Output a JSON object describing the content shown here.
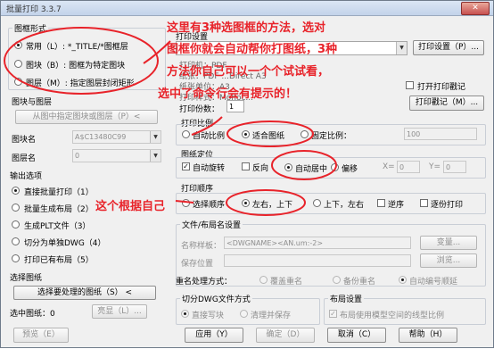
{
  "window": {
    "title": "批量打印 3.3.7",
    "close": "✕"
  },
  "pick": {
    "group": "图框形式",
    "opt1": "常用（L）: *_TITLE/*图框层",
    "opt2": "图块（B）: 图框为特定图块",
    "opt3": "图层（M）: 指定图层封闭矩形",
    "layer_group": "图块与图层",
    "pick_btn": "从图中指定图块或图层（P）<",
    "block_label": "图块名",
    "block_value": "A$C13480C99",
    "layer_label": "图层名",
    "layer_value": "0"
  },
  "output": {
    "group": "输出选项",
    "o1": "直接批量打印（1）",
    "o2": "批量生成布局（2）",
    "o3": "生成PLT文件（3）",
    "o4": "切分为单独DWG（4）",
    "o5": "打印已有布局（5）"
  },
  "select": {
    "group": "选择图纸",
    "btn": "选择要处理的图纸（S） <",
    "selected": "选中图纸：0",
    "highlight": "亮显（L）..."
  },
  "print_settings": {
    "group": "打印设置",
    "printer_value": "",
    "setup_btn": "打印设置（P）...",
    "bg_line1": "打印机：PDF",
    "bg_line2": "纸张：PDF ...Direct A3",
    "bg_line3": "纸张单位：A3",
    "bg_line4": "打印样式：Monoc...",
    "open_stamp": "打开打印戳记",
    "stamp_btn": "打印戳记（M）...",
    "copies_label": "打印份数：",
    "copies": "1"
  },
  "scale": {
    "group": "打印比例",
    "auto": "自动比例",
    "fit": "适合图纸",
    "fixed": "固定比例：",
    "fixed_value": "100"
  },
  "position": {
    "group": "图纸定位",
    "rotate": "自动旋转",
    "reverse": "反向",
    "center": "自动居中",
    "offset": "偏移",
    "x_label": "X=",
    "x_value": "0",
    "y_label": "Y=",
    "y_value": "0"
  },
  "order": {
    "group": "打印顺序",
    "select": "选择顺序",
    "lr": "左右，上下",
    "ud": "上下，左右",
    "reverse": "逆序",
    "sep": "逐份打印"
  },
  "file": {
    "group": "文件/布局名设置",
    "name_label": "名称样板：",
    "name_value": "<DWGNAME><AN.um:-2>",
    "change_btn": "变量...",
    "path_label": "保存位置",
    "browse_btn": "浏览...",
    "dup_label": "重名处理方式：",
    "d1": "覆盖重名",
    "d2": "备份重名",
    "d3": "自动编号顺延"
  },
  "split": {
    "group": "切分DWG文件方式",
    "s1": "直接写块",
    "s2": "清理并保存"
  },
  "layout": {
    "group": "布局设置",
    "c1": "布局使用模型空间的线型比例"
  },
  "buttons": {
    "preview": "预览（E）",
    "apply": "应用（Y）",
    "ok": "确定（D）",
    "cancel": "取消（C）",
    "help": "帮助（H）"
  },
  "annotations": {
    "line1": "这里有3种选图框的方法，选对",
    "line2": "图框你就会自动帮你打图纸，3种",
    "line3": "方法你自己可以一个个试试看，",
    "line4": "选中了命令行会有提示的！",
    "side": "这个根据自己",
    "color": "#e8232a"
  }
}
